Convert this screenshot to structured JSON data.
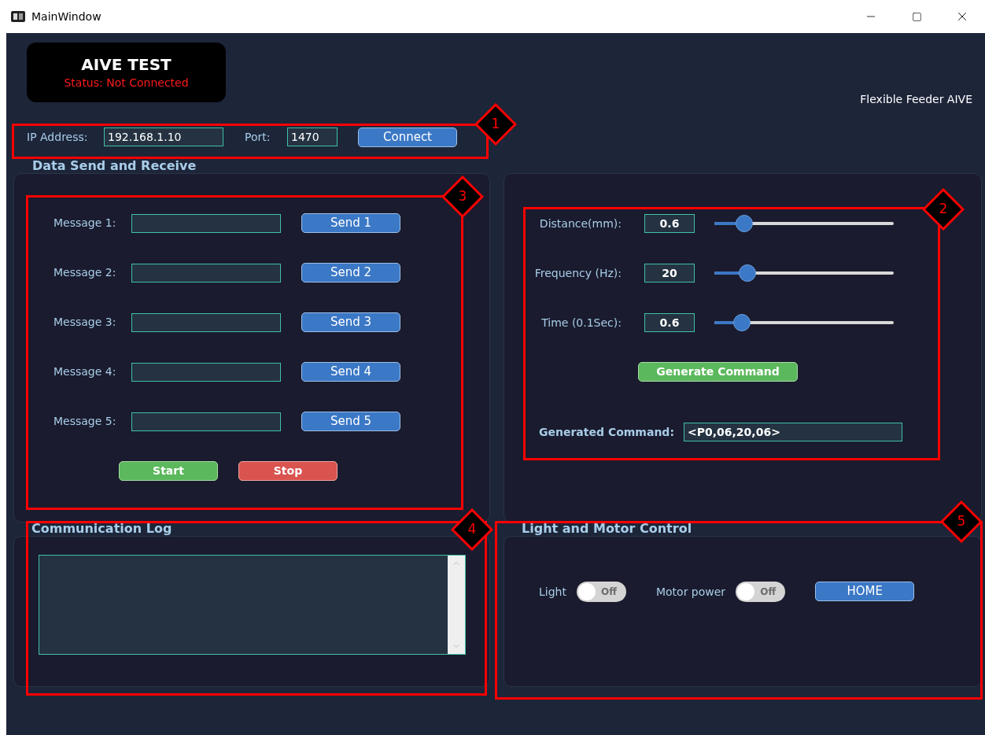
{
  "window": {
    "title": "MainWindow"
  },
  "header": {
    "title": "AIVE TEST",
    "status": "Status: Not Connected",
    "connected": false
  },
  "brand": "Flexible Feeder AIVE",
  "connection": {
    "ip_label": "IP Address:",
    "ip_value": "192.168.1.10",
    "port_label": "Port:",
    "port_value": "1470",
    "button": "Connect"
  },
  "send_group": {
    "title": "Data Send and Receive",
    "messages": [
      {
        "label": "Message 1:",
        "button": "Send 1"
      },
      {
        "label": "Message 2:",
        "button": "Send 2"
      },
      {
        "label": "Message 3:",
        "button": "Send 3"
      },
      {
        "label": "Message 4:",
        "button": "Send 4"
      },
      {
        "label": "Message 5:",
        "button": "Send 5"
      }
    ],
    "start": "Start",
    "stop": "Stop"
  },
  "command_panel": {
    "sliders": [
      {
        "label": "Distance(mm):",
        "value": "0.6",
        "level": 0.13
      },
      {
        "label": "Frequency (Hz):",
        "value": "20",
        "level": 0.15
      },
      {
        "label": "Time (0.1Sec):",
        "value": "0.6",
        "level": 0.12
      }
    ],
    "generate_button": "Generate Command",
    "result_label": "Generated Command:",
    "result_value": "<P0,06,20,06>"
  },
  "log": {
    "title": "Communication Log"
  },
  "control_group": {
    "title": "Light and Motor Control",
    "toggles": [
      {
        "label": "Light",
        "on": false,
        "state_text": "Off"
      },
      {
        "label": "Motor power",
        "on": false,
        "state_text": "Off"
      }
    ],
    "home_button": "HOME"
  },
  "annotations": [
    {
      "number": "1"
    },
    {
      "number": "2"
    },
    {
      "number": "3"
    },
    {
      "number": "4"
    },
    {
      "number": "5"
    }
  ]
}
